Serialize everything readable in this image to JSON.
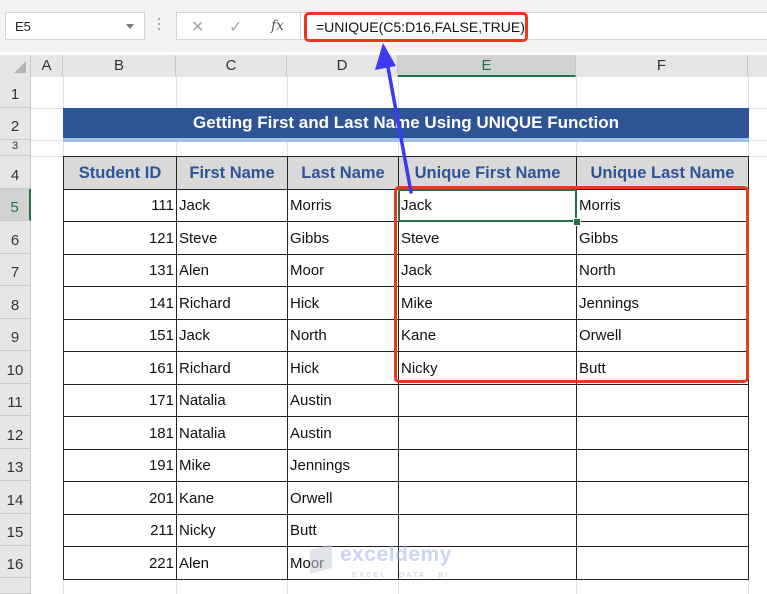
{
  "toolbar": {
    "name_box": "E5",
    "cancel_icon": "✕",
    "enter_icon": "✓",
    "fx_label": "fx",
    "formula": "=UNIQUE(C5:D16,FALSE,TRUE)"
  },
  "columns": [
    "A",
    "B",
    "C",
    "D",
    "E",
    "F"
  ],
  "selected_column": "E",
  "rows": [
    "1",
    "2",
    "3",
    "4",
    "5",
    "6",
    "7",
    "8",
    "9",
    "10",
    "11",
    "12",
    "13",
    "14",
    "15",
    "16"
  ],
  "selected_row": "5",
  "title": "Getting First and Last Name Using UNIQUE Function",
  "table": {
    "headers": [
      "Student ID",
      "First Name",
      "Last Name",
      "Unique First Name",
      "Unique Last Name"
    ],
    "rows": [
      {
        "id": "111",
        "first": "Jack",
        "last": "Morris",
        "ufirst": "Jack",
        "ulast": "Morris"
      },
      {
        "id": "121",
        "first": "Steve",
        "last": "Gibbs",
        "ufirst": "Steve",
        "ulast": "Gibbs"
      },
      {
        "id": "131",
        "first": "Alen",
        "last": "Moor",
        "ufirst": "Jack",
        "ulast": "North"
      },
      {
        "id": "141",
        "first": "Richard",
        "last": "Hick",
        "ufirst": "Mike",
        "ulast": "Jennings"
      },
      {
        "id": "151",
        "first": "Jack",
        "last": "North",
        "ufirst": "Kane",
        "ulast": "Orwell"
      },
      {
        "id": "161",
        "first": "Richard",
        "last": "Hick",
        "ufirst": "Nicky",
        "ulast": "Butt"
      },
      {
        "id": "171",
        "first": "Natalia",
        "last": "Austin",
        "ufirst": "",
        "ulast": ""
      },
      {
        "id": "181",
        "first": "Natalia",
        "last": "Austin",
        "ufirst": "",
        "ulast": ""
      },
      {
        "id": "191",
        "first": "Mike",
        "last": "Jennings",
        "ufirst": "",
        "ulast": ""
      },
      {
        "id": "201",
        "first": "Kane",
        "last": "Orwell",
        "ufirst": "",
        "ulast": ""
      },
      {
        "id": "211",
        "first": "Nicky",
        "last": "Butt",
        "ufirst": "",
        "ulast": ""
      },
      {
        "id": "221",
        "first": "Alen",
        "last": "Moor",
        "ufirst": "",
        "ulast": ""
      }
    ]
  },
  "watermark": {
    "brand": "exceldemy",
    "tagline": "EXCEL · DATA · BI"
  },
  "colors": {
    "title_band": "#2f5496",
    "header_text": "#2f5496",
    "header_fill": "#d9d9d9",
    "highlight": "#e8391f",
    "arrow": "#3b3bf0",
    "selection": "#217346"
  }
}
